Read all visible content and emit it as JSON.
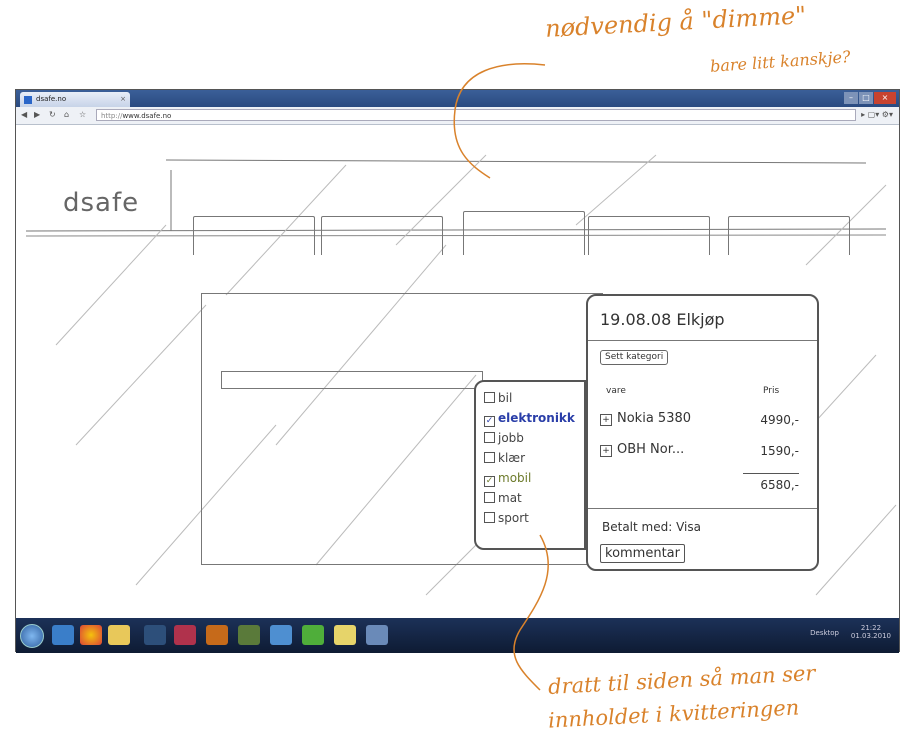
{
  "annotations": {
    "top_line1": "nødvendig å \"dimme\"",
    "top_line2": "bare litt kanskje?",
    "bottom_line1": "dratt til siden så man ser",
    "bottom_line2": "innholdet i kvitteringen"
  },
  "browser": {
    "tab_title": "dsafe.no",
    "address_http": "http://",
    "address_host": "www.dsafe.no"
  },
  "site": {
    "logo": "dsafe"
  },
  "receipt": {
    "title": "19.08.08  Elkjøp",
    "category_button": "Sett kategori",
    "col_item": "vare",
    "col_price": "Pris",
    "items": [
      {
        "name": "Nokia 5380",
        "price": "4990,-"
      },
      {
        "name": "OBH Nor...",
        "price": "1590,-"
      }
    ],
    "total": "6580,-",
    "paid_with": "Betalt med: Visa",
    "comment_button": "kommentar"
  },
  "categories": [
    {
      "label": "bil",
      "checked": false
    },
    {
      "label": "elektronikk",
      "checked": true
    },
    {
      "label": "jobb",
      "checked": false
    },
    {
      "label": "klær",
      "checked": false
    },
    {
      "label": "mobil",
      "checked": true
    },
    {
      "label": "mat",
      "checked": false
    },
    {
      "label": "sport",
      "checked": false
    }
  ],
  "taskbar": {
    "tray_text": "Desktop",
    "clock_time": "21:22",
    "clock_date": "01.03.2010"
  }
}
